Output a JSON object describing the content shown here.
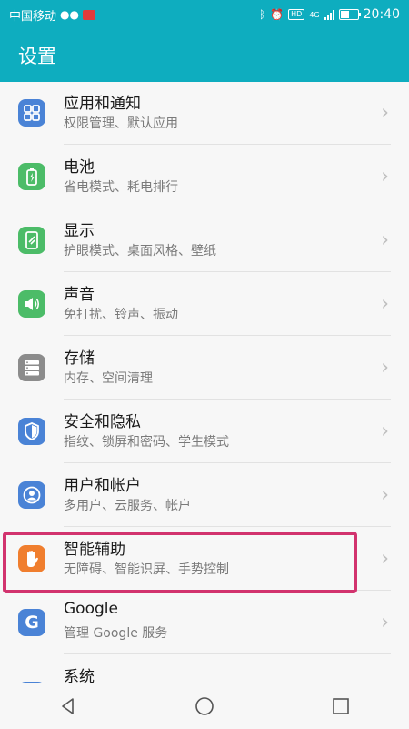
{
  "status_bar": {
    "carrier": "中国移动",
    "hd_badge": "HD",
    "network_badge": "4G",
    "time": "20:40"
  },
  "app_bar": {
    "title": "设置"
  },
  "colors": {
    "accent": "#0eadbf",
    "highlight": "#d2336e",
    "icon_blue": "#4a83d6",
    "icon_green": "#4cbc68",
    "icon_gray": "#8c8c8c",
    "icon_orange": "#f07e2e"
  },
  "settings": [
    {
      "title": "应用和通知",
      "subtitle": "权限管理、默认应用",
      "icon": "apps-grid-icon",
      "color": "#4a83d6"
    },
    {
      "title": "电池",
      "subtitle": "省电模式、耗电排行",
      "icon": "battery-icon",
      "color": "#4cbc68"
    },
    {
      "title": "显示",
      "subtitle": "护眼模式、桌面风格、壁纸",
      "icon": "display-icon",
      "color": "#4cbc68"
    },
    {
      "title": "声音",
      "subtitle": "免打扰、铃声、振动",
      "icon": "sound-icon",
      "color": "#4cbc68"
    },
    {
      "title": "存储",
      "subtitle": "内存、空间清理",
      "icon": "storage-icon",
      "color": "#8c8c8c"
    },
    {
      "title": "安全和隐私",
      "subtitle": "指纹、锁屏和密码、学生模式",
      "icon": "shield-icon",
      "color": "#4a83d6"
    },
    {
      "title": "用户和帐户",
      "subtitle": "多用户、云服务、帐户",
      "icon": "user-icon",
      "color": "#4a83d6"
    },
    {
      "title": "智能辅助",
      "subtitle": "无障碍、智能识屏、手势控制",
      "icon": "hand-icon",
      "color": "#f07e2e"
    },
    {
      "title": "Google",
      "subtitle": "管理 Google 服务",
      "icon": "google-icon",
      "color": "#4a83d6"
    },
    {
      "title": "系统",
      "subtitle": "",
      "icon": "system-icon",
      "color": "#4a83d6"
    }
  ],
  "nav_bar": {
    "buttons": [
      "back-icon",
      "home-icon",
      "recents-icon"
    ]
  }
}
